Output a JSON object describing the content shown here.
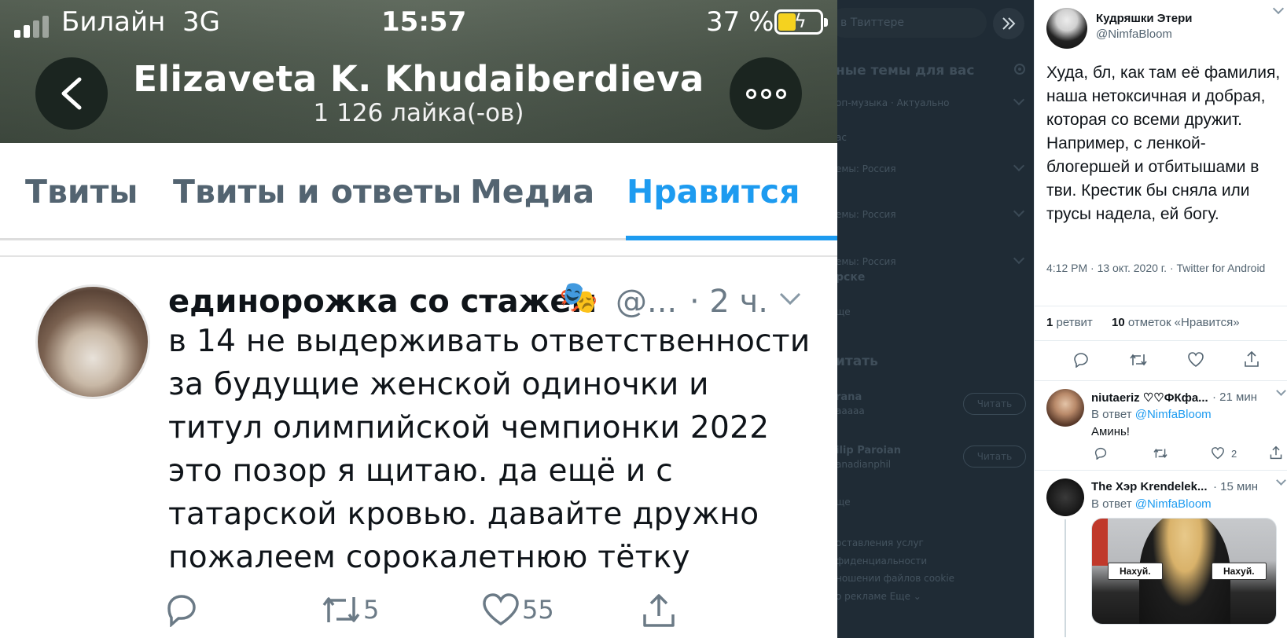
{
  "phone": {
    "status": {
      "carrier": "Билайн",
      "network": "3G",
      "time": "15:57",
      "battery": "37 %"
    },
    "profile": {
      "name": "Elizaveta K. Khudaiberdieva",
      "likes": "1 126 лайка(-ов)"
    },
    "tabs": [
      {
        "label": "Твиты",
        "active": false
      },
      {
        "label": "Твиты и ответы",
        "active": false
      },
      {
        "label": "Медиа",
        "active": false
      },
      {
        "label": "Нравится",
        "active": true
      }
    ],
    "tweet": {
      "author": "единорожка со стажем",
      "author_emoji": "🎭",
      "handle": "@...",
      "time": "· 2 ч.",
      "text": "в 14 не выдерживать ответственности за будущие женской одиночки и титул олимпийской чемпионки 2022 это позор я щитаю. да ещё и с татарской кровью. давайте дружно пожалеем сорокалетнюю тётку",
      "retweets": "5",
      "likes": "55"
    },
    "accent_color": "#1d9bf0"
  },
  "sidebar_dimmed": {
    "search_placeholder": "в Твиттере",
    "trends_title": "ные темы для вас",
    "trends": [
      "оп-музыка · Актуально",
      "ас",
      "емы: Россия",
      "емы: Россия",
      "емы: Россия"
    ],
    "trend_name": "рске",
    "show_more": "ще",
    "who_to_follow": "итать",
    "accounts": [
      {
        "name": "rana",
        "handle": "aaaaa",
        "button": "Читать"
      },
      {
        "name": "ilip Paroian",
        "handle": "anadianphil",
        "button": "Читать"
      }
    ],
    "show_more_2": "ще",
    "footer": [
      "оставления услуг",
      "фиденциальности",
      "ношении файлов cookie",
      "о рекламе  Еще ⌄"
    ]
  },
  "detail": {
    "author": {
      "name": "Кудряшки Этери",
      "handle": "@NimfaBloom"
    },
    "text": "Худа, бл, как там её фамилия, наша нетоксичная и добрая, которая со всеми дружит. Например, с ленкой-блогершей и отбитышами в тви. Крестик бы сняла или трусы надела, ей богу.",
    "meta": "4:12 PM · 13 окт. 2020 г. · Twitter for Android",
    "stats": {
      "retweets_count": "1",
      "retweets_label": "ретвит",
      "likes_count": "10",
      "likes_label": "отметок «Нравится»"
    },
    "replies": [
      {
        "name": "niutaeriz ♡♡ФКфа...",
        "time": "· 21 мин",
        "reply_to_label": "В ответ",
        "reply_to": "@NimfaBloom",
        "body": "Аминь!",
        "likes": "2"
      },
      {
        "name": "The Хэр Krendelek...",
        "time": "· 15 мин",
        "reply_to_label": "В ответ",
        "reply_to": "@NimfaBloom",
        "captions": [
          "Нахуй.",
          "Нахуй."
        ]
      }
    ]
  }
}
